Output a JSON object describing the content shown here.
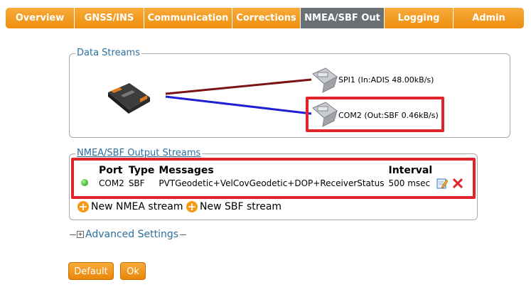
{
  "nav": {
    "tabs": [
      {
        "label": "Overview"
      },
      {
        "label": "GNSS/INS"
      },
      {
        "label": "Communication"
      },
      {
        "label": "Corrections"
      },
      {
        "label": "NMEA/SBF Out",
        "active": true
      },
      {
        "label": "Logging"
      },
      {
        "label": "Admin"
      }
    ]
  },
  "data_streams": {
    "legend": "Data Streams",
    "ports": [
      {
        "label": "SPI1 (In:ADIS 48.00kB/s)",
        "line_color": "#7a1313"
      },
      {
        "label": "COM2 (Out:SBF 0.46kB/s)",
        "line_color": "#1f1fd6"
      }
    ]
  },
  "output_streams": {
    "legend": "NMEA/SBF Output Streams",
    "headers": {
      "port": "Port",
      "type": "Type",
      "messages": "Messages",
      "interval": "Interval"
    },
    "rows": [
      {
        "status": "active",
        "port": "COM2",
        "type": "SBF",
        "messages": "PVTGeodetic+VelCovGeodetic+DOP+ReceiverStatus",
        "interval": "500 msec"
      }
    ],
    "new_nmea": "New NMEA stream",
    "new_sbf": "New SBF stream"
  },
  "advanced": {
    "label": "Advanced Settings",
    "toggle": "+"
  },
  "buttons": {
    "default": "Default",
    "ok": "Ok"
  },
  "colors": {
    "accent": "#f39b1b",
    "active_tab": "#6a6f73",
    "highlight": "#e1242b",
    "legend": "#2c6f9e"
  }
}
